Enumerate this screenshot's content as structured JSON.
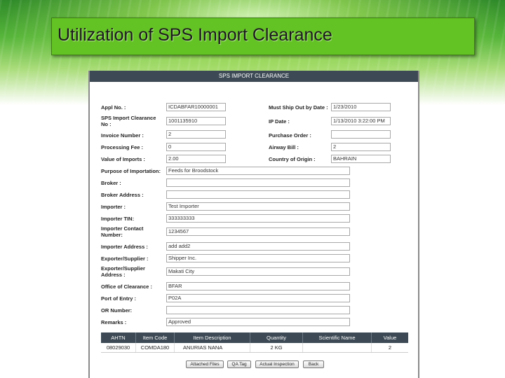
{
  "slide": {
    "title": "Utilization of SPS Import Clearance"
  },
  "form": {
    "header": "SPS IMPORT CLEARANCE",
    "fields": {
      "appl_no": {
        "label": "Appl No. :",
        "value": "ICDABFAR10000001"
      },
      "sps_clearance_no": {
        "label": "SPS Import Clearance No :",
        "value": "1001135910"
      },
      "invoice_number": {
        "label": "Invoice Number :",
        "value": "2"
      },
      "processing_fee": {
        "label": "Processing Fee :",
        "value": "0"
      },
      "value_of_imports": {
        "label": "Value of Imports :",
        "value": "2.00"
      },
      "must_ship_out_by_date": {
        "label": "Must Ship Out by Date :",
        "value": "1/23/2010"
      },
      "ip_date": {
        "label": "IP Date :",
        "value": "1/13/2010 3:22:00 PM"
      },
      "purchase_order": {
        "label": "Purchase Order :",
        "value": ""
      },
      "airway_bill": {
        "label": "Airway Bill :",
        "value": "2"
      },
      "country_of_origin": {
        "label": "Country of Origin :",
        "value": "BAHRAIN"
      },
      "purpose_of_importation": {
        "label": "Purpose of Importation:",
        "value": "Feeds for Broodstock"
      },
      "broker": {
        "label": "Broker :",
        "value": ""
      },
      "broker_address": {
        "label": "Broker Address :",
        "value": ""
      },
      "importer": {
        "label": "Importer :",
        "value": "Test Importer"
      },
      "importer_tin": {
        "label": "Importer TIN:",
        "value": "333333333"
      },
      "importer_contact": {
        "label": "Importer Contact Number:",
        "value": "1234567"
      },
      "importer_address": {
        "label": "Importer Address :",
        "value": "add add2"
      },
      "exporter_supplier": {
        "label": "Exporter/Supplier :",
        "value": "Shipper Inc."
      },
      "exporter_supplier_address": {
        "label": "Exporter/Supplier Address :",
        "value": "Makati City"
      },
      "office_of_clearance": {
        "label": "Office of Clearance :",
        "value": "BFAR"
      },
      "port_of_entry": {
        "label": "Port of Entry :",
        "value": "P02A"
      },
      "or_number": {
        "label": "OR Number:",
        "value": ""
      },
      "remarks": {
        "label": "Remarks :",
        "value": "Approved"
      }
    },
    "table": {
      "headers": [
        "AHTN",
        "Item Code",
        "Item Description",
        "Quantity",
        "Scientific Name",
        "Value"
      ],
      "rows": [
        [
          "08029030",
          "COMDA180",
          "ANURIAS NANA",
          "2  KG",
          "",
          "2"
        ]
      ]
    },
    "buttons": {
      "attached_files": "Attached Files",
      "qa_tag": "QA Tag",
      "actual_inspection": "Actual Inspection",
      "back": "Back"
    }
  }
}
